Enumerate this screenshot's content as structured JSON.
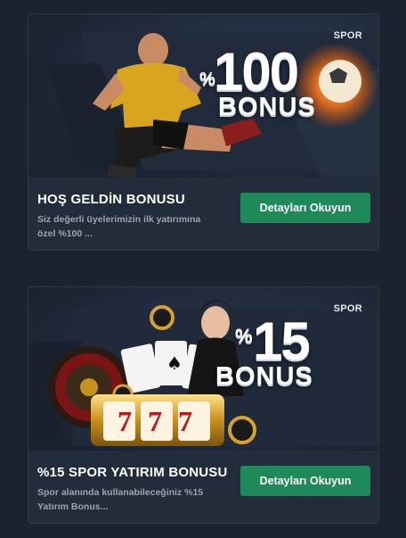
{
  "cards": [
    {
      "tag": "SPOR",
      "percent_sign": "%",
      "percent_value": "100",
      "bonus_word": "BONUS",
      "title": "HOŞ GELDİN BONUSU",
      "description": "Siz değerli üyelerimizin ilk yatırımına özel %100 ...",
      "button_label": "Detayları Okuyun"
    },
    {
      "tag": "SPOR",
      "percent_sign": "%",
      "percent_value": "15",
      "bonus_word": "BONUS",
      "slot_text": "777",
      "title": "%15 SPOR YATIRIM BONUSU",
      "description": "Spor alanında kullanabileceğiniz %15 Yatırım Bonus...",
      "button_label": "Detayları Okuyun"
    }
  ],
  "colors": {
    "background": "#1b2230",
    "card": "#232c3b",
    "button": "#1e8a5a",
    "banner": "#1e2635"
  }
}
